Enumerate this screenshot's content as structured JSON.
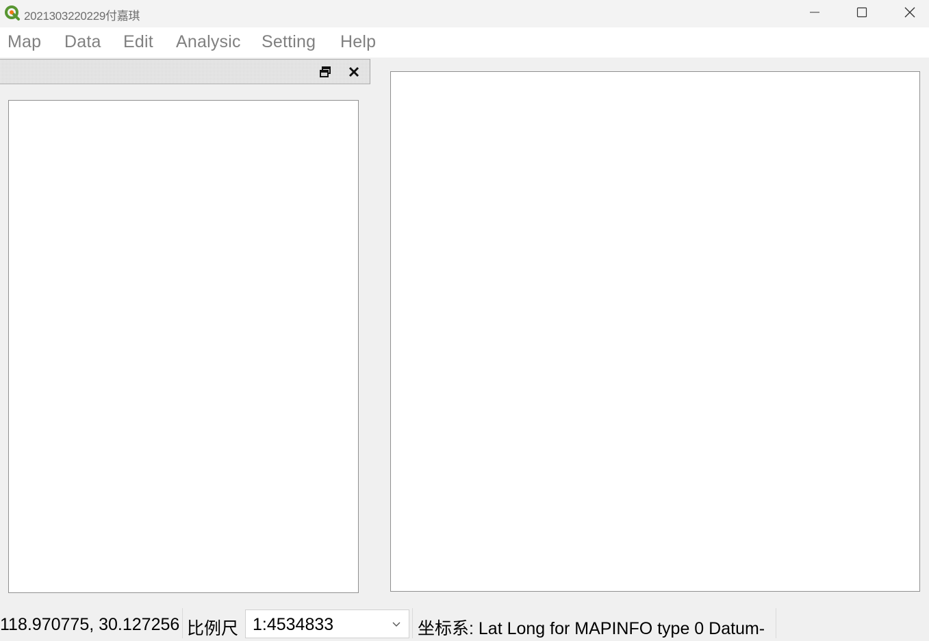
{
  "window": {
    "title": "2021303220229付嘉琪",
    "app_icon": "qgis-logo-icon",
    "controls": [
      "minimize-icon",
      "maximize-icon",
      "close-icon"
    ]
  },
  "menu": {
    "items": [
      {
        "label": "Map"
      },
      {
        "label": "Data"
      },
      {
        "label": "Edit"
      },
      {
        "label": "Analysic"
      },
      {
        "label": "Setting"
      },
      {
        "label": "Help"
      }
    ]
  },
  "dock": {
    "float_icon": "float-restore-icon",
    "close_icon": "close-x-icon"
  },
  "status": {
    "coordinates": "118.970775, 30.127256",
    "scale_label": "比例尺",
    "scale_value": "1:4534833",
    "crs_text": "坐标系: Lat Long for MAPINFO type 0 Datum-"
  },
  "colors": {
    "brand_green": "#589632",
    "brand_yellow": "#ee7913",
    "menu_text": "#808080"
  }
}
